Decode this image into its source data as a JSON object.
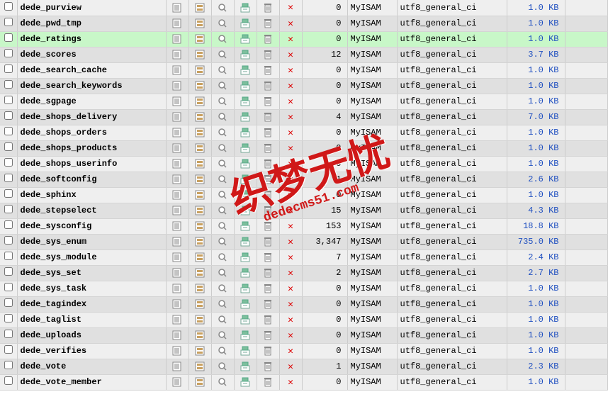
{
  "engine": "MyISAM",
  "collation": "utf8_general_ci",
  "watermark": {
    "text": "织梦无忧",
    "url": "dedecms51.com"
  },
  "rows": [
    {
      "name": "dede_purview",
      "rows": "0",
      "size": "1.0 KB",
      "cls": "odd"
    },
    {
      "name": "dede_pwd_tmp",
      "rows": "0",
      "size": "1.0 KB",
      "cls": "even"
    },
    {
      "name": "dede_ratings",
      "rows": "0",
      "size": "1.0 KB",
      "cls": "hl"
    },
    {
      "name": "dede_scores",
      "rows": "12",
      "size": "3.7 KB",
      "cls": "even"
    },
    {
      "name": "dede_search_cache",
      "rows": "0",
      "size": "1.0 KB",
      "cls": "odd"
    },
    {
      "name": "dede_search_keywords",
      "rows": "0",
      "size": "1.0 KB",
      "cls": "even"
    },
    {
      "name": "dede_sgpage",
      "rows": "0",
      "size": "1.0 KB",
      "cls": "odd"
    },
    {
      "name": "dede_shops_delivery",
      "rows": "4",
      "size": "7.0 KB",
      "cls": "even"
    },
    {
      "name": "dede_shops_orders",
      "rows": "0",
      "size": "1.0 KB",
      "cls": "odd"
    },
    {
      "name": "dede_shops_products",
      "rows": "0",
      "size": "1.0 KB",
      "cls": "even"
    },
    {
      "name": "dede_shops_userinfo",
      "rows": "0",
      "size": "1.0 KB",
      "cls": "odd"
    },
    {
      "name": "dede_softconfig",
      "rows": "1",
      "size": "2.6 KB",
      "cls": "even"
    },
    {
      "name": "dede_sphinx",
      "rows": "0",
      "size": "1.0 KB",
      "cls": "odd"
    },
    {
      "name": "dede_stepselect",
      "rows": "15",
      "size": "4.3 KB",
      "cls": "even"
    },
    {
      "name": "dede_sysconfig",
      "rows": "153",
      "size": "18.8 KB",
      "cls": "odd"
    },
    {
      "name": "dede_sys_enum",
      "rows": "3,347",
      "size": "735.0 KB",
      "cls": "even"
    },
    {
      "name": "dede_sys_module",
      "rows": "7",
      "size": "2.4 KB",
      "cls": "odd"
    },
    {
      "name": "dede_sys_set",
      "rows": "2",
      "size": "2.7 KB",
      "cls": "even"
    },
    {
      "name": "dede_sys_task",
      "rows": "0",
      "size": "1.0 KB",
      "cls": "odd"
    },
    {
      "name": "dede_tagindex",
      "rows": "0",
      "size": "1.0 KB",
      "cls": "even"
    },
    {
      "name": "dede_taglist",
      "rows": "0",
      "size": "1.0 KB",
      "cls": "odd"
    },
    {
      "name": "dede_uploads",
      "rows": "0",
      "size": "1.0 KB",
      "cls": "even"
    },
    {
      "name": "dede_verifies",
      "rows": "0",
      "size": "1.0 KB",
      "cls": "odd"
    },
    {
      "name": "dede_vote",
      "rows": "1",
      "size": "2.3 KB",
      "cls": "even"
    },
    {
      "name": "dede_vote_member",
      "rows": "0",
      "size": "1.0 KB",
      "cls": "odd"
    }
  ]
}
